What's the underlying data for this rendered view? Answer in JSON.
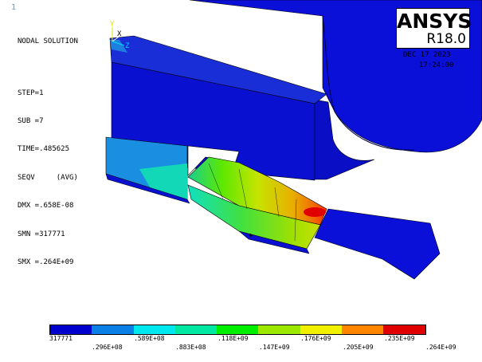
{
  "window_id": "1",
  "info_lines": {
    "title": "NODAL SOLUTION",
    "step": "STEP=1",
    "sub": "SUB =7",
    "time": "TIME=.485625",
    "seqv": "SEQV     (AVG)",
    "dmx": "DMX =.658E-08",
    "smn": "SMN =317771",
    "smx": "SMX =.264E+09"
  },
  "logo": {
    "name": "ANSYS",
    "version": "R18.0"
  },
  "date_text": "DEC 17 2023",
  "time_text": "17:24:00",
  "triad": {
    "y": "Y",
    "x": "X",
    "z": "Z"
  },
  "legend": {
    "colors": [
      "#0000ce",
      "#0a80e6",
      "#00e8ef",
      "#00e8a2",
      "#00ee00",
      "#9ce800",
      "#f0f000",
      "#ff8400",
      "#e00000"
    ],
    "labels_top_row": [
      "317771",
      ".589E+08",
      ".118E+09",
      ".176E+09",
      ".235E+09"
    ],
    "labels_bottom_row": [
      ".296E+08",
      ".883E+08",
      ".147E+09",
      ".205E+09",
      ".264E+09"
    ]
  }
}
